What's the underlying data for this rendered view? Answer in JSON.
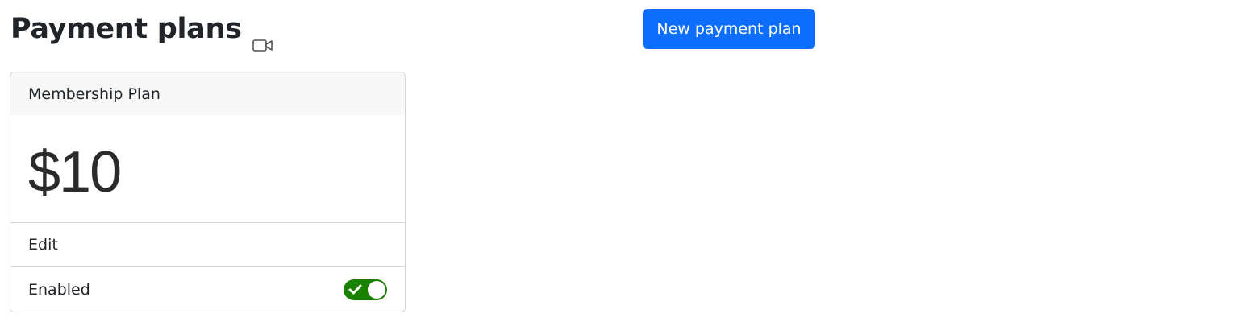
{
  "header": {
    "title": "Payment plans",
    "video_icon": "video-camera-icon"
  },
  "actions": {
    "new_plan_label": "New payment plan"
  },
  "plans": [
    {
      "name": "Membership Plan",
      "price": "$10",
      "edit_label": "Edit",
      "status_label": "Enabled",
      "enabled": true
    }
  ],
  "colors": {
    "primary_button": "#0d6efd",
    "toggle_on": "#198000",
    "card_header_bg": "#f7f7f7",
    "border": "#d6d6d6"
  }
}
